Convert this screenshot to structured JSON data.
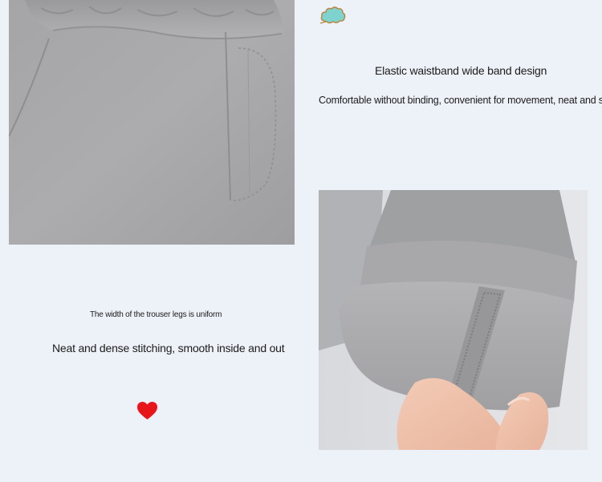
{
  "features": {
    "waistband_title": "Elastic waistband wide band design",
    "waistband_desc": "Comfortable without binding, convenient for movement, neat and stylish",
    "legs_note": "The width of the trouser legs is uniform",
    "stitching_title": "Neat and dense stitching, smooth inside and out"
  },
  "icons": {
    "decoration_top": "cloud-icon",
    "decoration_bottom": "heart-icon"
  },
  "colors": {
    "background": "#edf1f8",
    "fabric": "#a9a9ab",
    "heart": "#e8151b",
    "cloud": "#6ec9c7"
  }
}
